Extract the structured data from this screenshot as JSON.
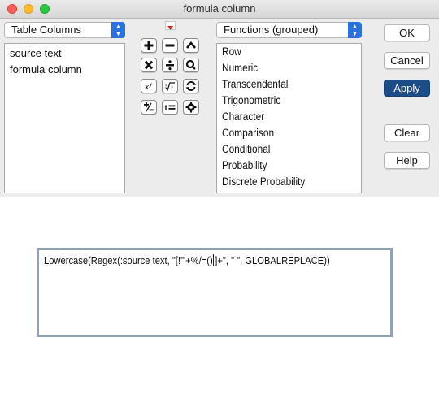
{
  "window": {
    "title": "formula column"
  },
  "columns_popup": {
    "selected": "Table Columns"
  },
  "columns": [
    "source text",
    "formula column"
  ],
  "functions_popup": {
    "selected": "Functions (grouped)"
  },
  "functions": [
    "Row",
    "Numeric",
    "Transcendental",
    "Trigonometric",
    "Character",
    "Comparison",
    "Conditional",
    "Probability",
    "Discrete Probability"
  ],
  "keypad": [
    [
      "plus-icon",
      "minus-icon",
      "caret-up-icon"
    ],
    [
      "multiply-icon",
      "divide-icon",
      "search-icon"
    ],
    [
      "power-icon",
      "root-icon",
      "swap-icon"
    ],
    [
      "plus-minus-icon",
      "assign-icon",
      "gear-icon"
    ]
  ],
  "buttons": {
    "ok": "OK",
    "cancel": "Cancel",
    "apply": "Apply",
    "clear": "Clear",
    "help": "Help"
  },
  "formula": {
    "before_caret": "Lowercase(Regex(:source text, \"[!'\"+%/=()",
    "after_caret": "]+\", \" \", GLOBALREPLACE))"
  },
  "colors": {
    "apply_button": "#1d4d86",
    "popup_accent": "#2a72e0",
    "expander": "#e0201b"
  }
}
